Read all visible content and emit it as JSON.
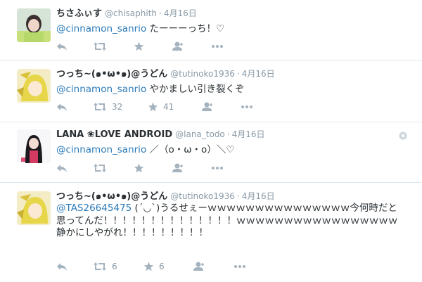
{
  "tweets": [
    {
      "name": "ちさふぃす",
      "handle": "@chisaphith",
      "dot": "·",
      "time": "4月16日",
      "mention": "@cinnamon_sanrio",
      "text": " たーーーっち！♡",
      "retweets": "",
      "favorites": ""
    },
    {
      "name": "つっち~(๑•ω•๑)@うどん",
      "handle": "@tutinoko1936",
      "dot": "·",
      "time": "4月16日",
      "mention": "@cinnamon_sanrio",
      "text": " やかましい引き裂くぞ",
      "retweets": "32",
      "favorites": "41"
    },
    {
      "name": "LANA ❀LOVE ANDROID",
      "handle": "@lana_todo",
      "dot": "·",
      "time": "4月16日",
      "mention": "@cinnamon_sanrio",
      "text": " ／（o・ω・o）＼♡",
      "retweets": "",
      "favorites": ""
    },
    {
      "name": "つっち~(๑•ω•๑)@うどん",
      "handle": "@tutinoko1936",
      "dot": "·",
      "time": "4月16日",
      "mention": "@TAS26645475",
      "text": " (´◡`)うるせぇーｗｗｗｗｗｗｗｗｗｗｗｗｗｗｗ今何時だと思ってんだ！！！！！！！！！！！！！！ｗｗｗｗｗｗｗｗｗｗｗｗｗｗｗｗｗ静かにしやがれ！！！！！！！！！",
      "retweets": "6",
      "favorites": "6"
    }
  ],
  "colors": {
    "accent": "#2b7bb9",
    "meta": "#8899a6",
    "icon": "#a5b3bf",
    "border": "#e1e8ed"
  }
}
